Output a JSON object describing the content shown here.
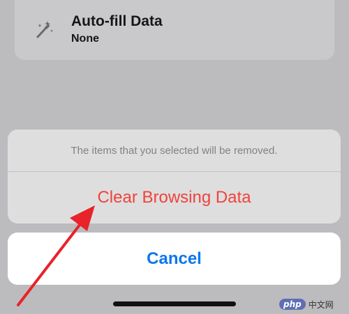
{
  "background_row": {
    "icon": "magic-wand-icon",
    "title": "Auto-fill Data",
    "subtitle": "None"
  },
  "action_sheet": {
    "message": "The items that you selected will be removed.",
    "destructive_label": "Clear Browsing Data",
    "cancel_label": "Cancel"
  },
  "watermark": {
    "logo": "php",
    "text": "中文网"
  },
  "colors": {
    "destructive": "#f0433a",
    "cancel": "#0a77f0",
    "annotation_arrow": "#e8232a"
  }
}
